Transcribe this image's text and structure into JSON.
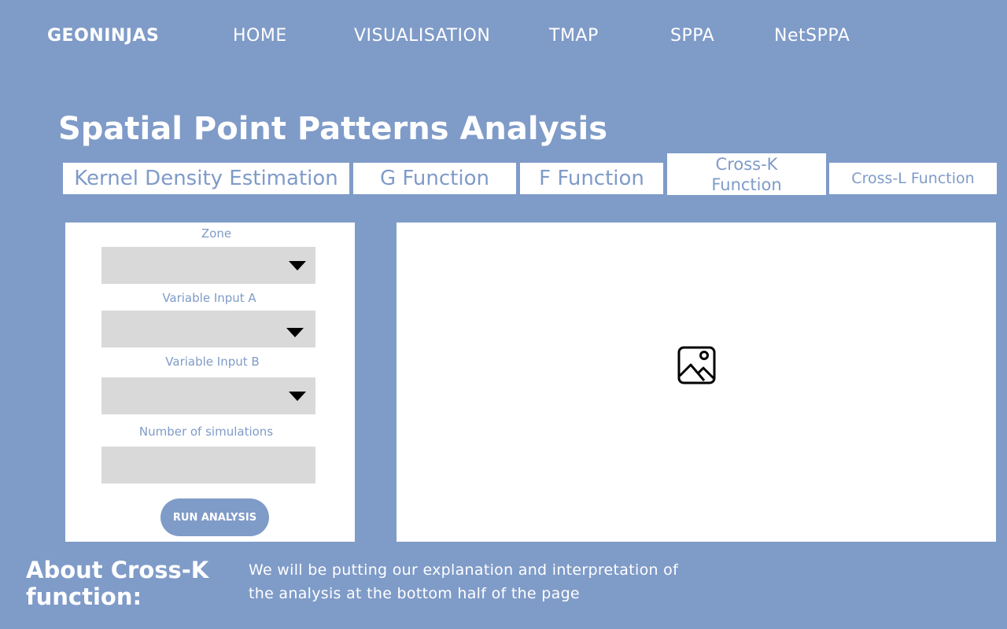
{
  "nav": {
    "brand": "GEONINJAS",
    "items": [
      "HOME",
      "VISUALISATION",
      "TMAP",
      "SPPA",
      "NetSPPA"
    ]
  },
  "page": {
    "title": "Spatial Point Patterns Analysis"
  },
  "tabs": [
    "Kernel Density Estimation",
    "G Function",
    "F Function",
    "Cross-K Function",
    "Cross-L Function"
  ],
  "form": {
    "zone_label": "Zone",
    "var_a_label": "Variable Input A",
    "var_b_label": "Variable Input B",
    "sims_label": "Number of simulations",
    "run_label": "RUN ANALYSIS"
  },
  "output": {
    "icon": "image-placeholder-icon"
  },
  "about": {
    "heading": "About Cross-K function:",
    "text": "We will be putting our explanation and interpretation of the analysis at the bottom half of the page"
  },
  "colors": {
    "background": "#7f9bc8",
    "panel": "#ffffff",
    "field": "#d9d9d9"
  }
}
